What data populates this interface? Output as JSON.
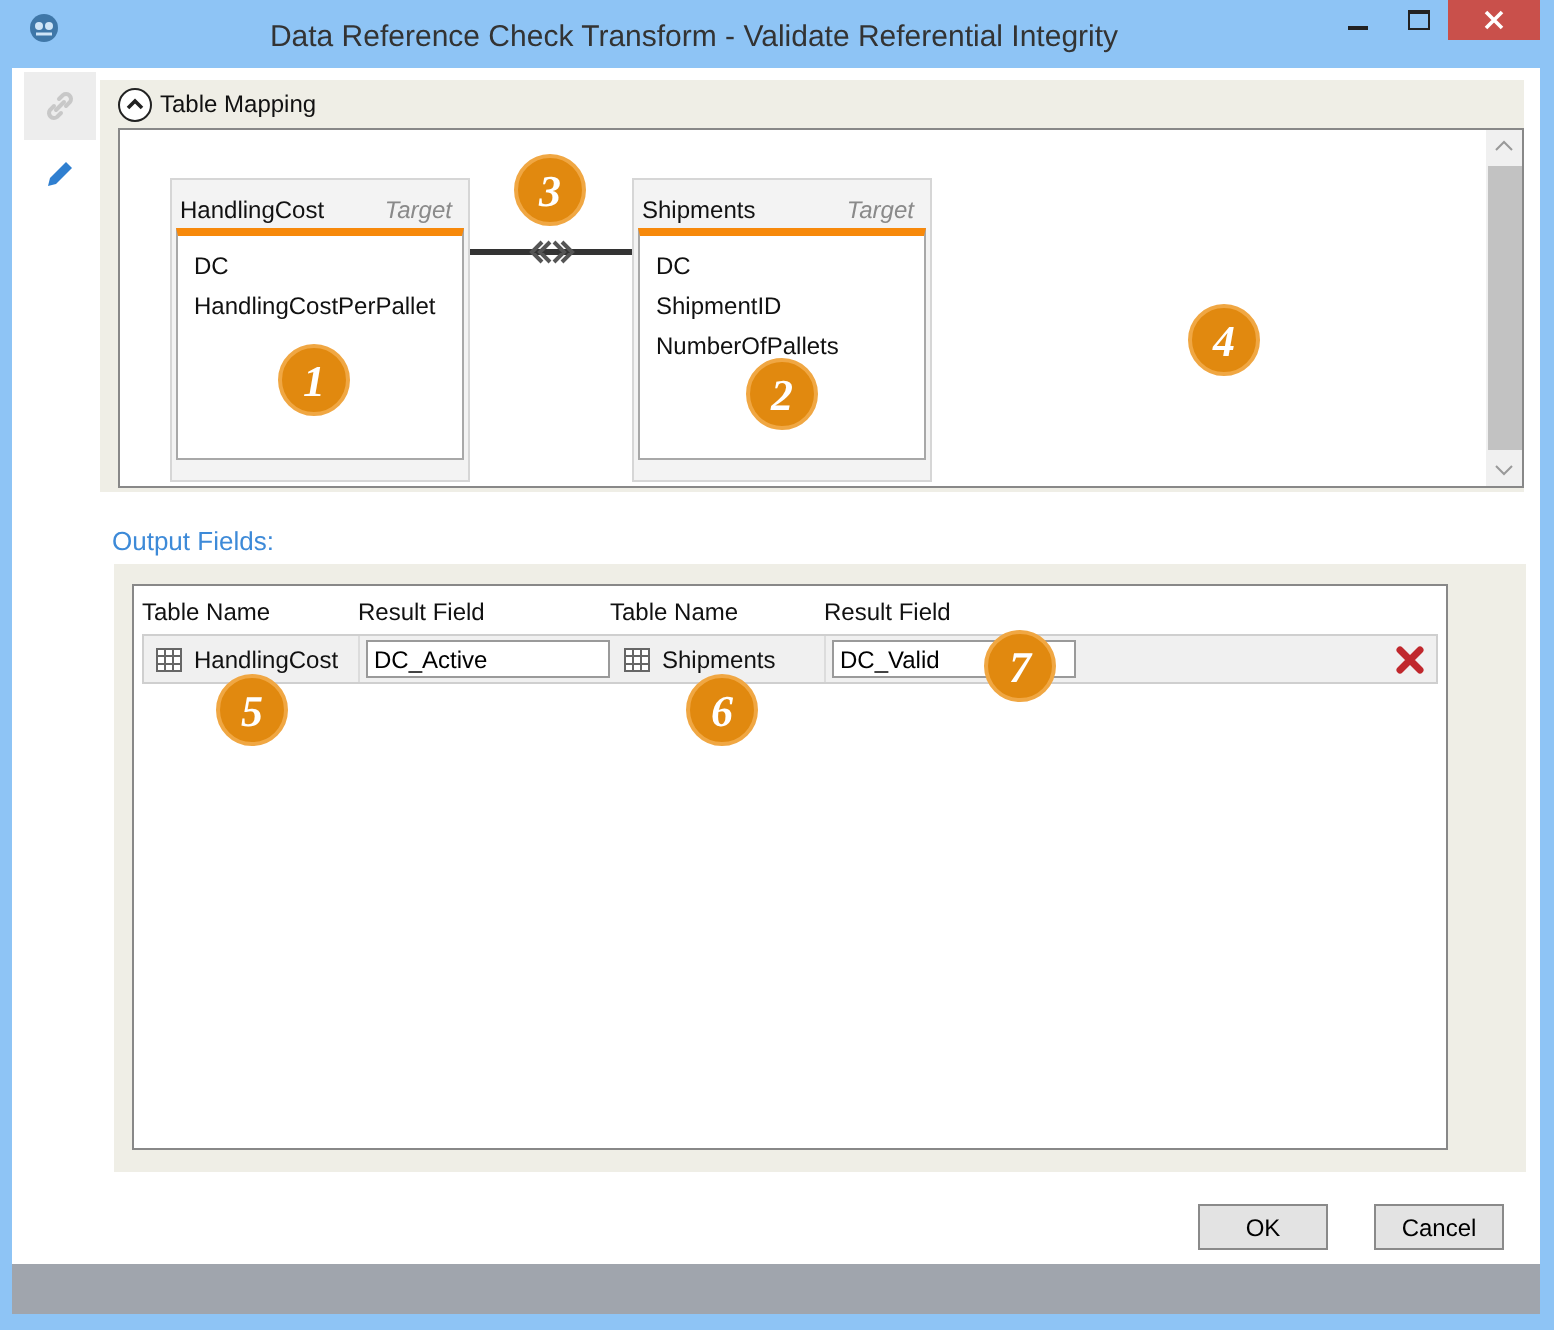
{
  "window": {
    "title": "Data Reference Check Transform - Validate Referential Integrity"
  },
  "sidebar": {
    "tabs": [
      {
        "selected": false
      },
      {
        "selected": true
      }
    ]
  },
  "table_mapping": {
    "title": "Table Mapping",
    "expanded": true,
    "tables": [
      {
        "name": "HandlingCost",
        "role": "Target",
        "fields": [
          "DC",
          "HandlingCostPerPallet"
        ]
      },
      {
        "name": "Shipments",
        "role": "Target",
        "fields": [
          "DC",
          "ShipmentID",
          "NumberOfPallets"
        ]
      }
    ]
  },
  "output_fields": {
    "title": "Output Fields:",
    "columns": [
      "Table Name",
      "Result Field",
      "Table Name",
      "Result Field"
    ],
    "rows": [
      {
        "table_1": "HandlingCost",
        "result_1": "DC_Active",
        "table_2": "Shipments",
        "result_2": "DC_Valid"
      }
    ]
  },
  "buttons": [
    "OK",
    "Cancel"
  ],
  "callouts": [
    "1",
    "2",
    "3",
    "4",
    "5",
    "6",
    "7"
  ]
}
